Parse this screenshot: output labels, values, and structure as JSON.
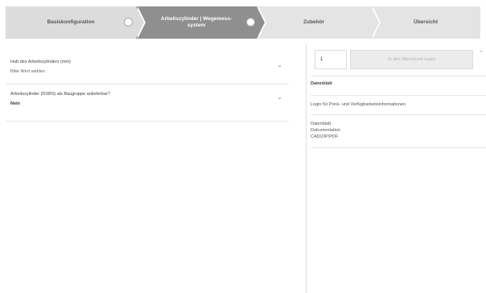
{
  "stepper": {
    "steps": [
      {
        "label_line1": "Basiskonfiguration",
        "label_line2": ""
      },
      {
        "label_line1": "Arbeitszylinder | Wegemess-",
        "label_line2": "system"
      },
      {
        "label_line1": "Zubehör",
        "label_line2": ""
      },
      {
        "label_line1": "Übersicht",
        "label_line2": ""
      }
    ],
    "active_index": 1
  },
  "fields": [
    {
      "label": "Hub des Arbeitszylinders (mm)",
      "value": "Bitte Wert wählen"
    },
    {
      "label": "Arbeitszylinder (DSBS) als Baugruppe anlieferbar?",
      "value": "Nein"
    }
  ],
  "panel": {
    "quantity": "1",
    "cart_button": "In den Warenkorb legen",
    "section_title": "Datenblatt",
    "login_text": "Login für Preis- und Verfügbarkeitsinformationen",
    "downloads": [
      "Datenblatt",
      "Dokumentation",
      "CAD/ZIP/PDF"
    ]
  }
}
